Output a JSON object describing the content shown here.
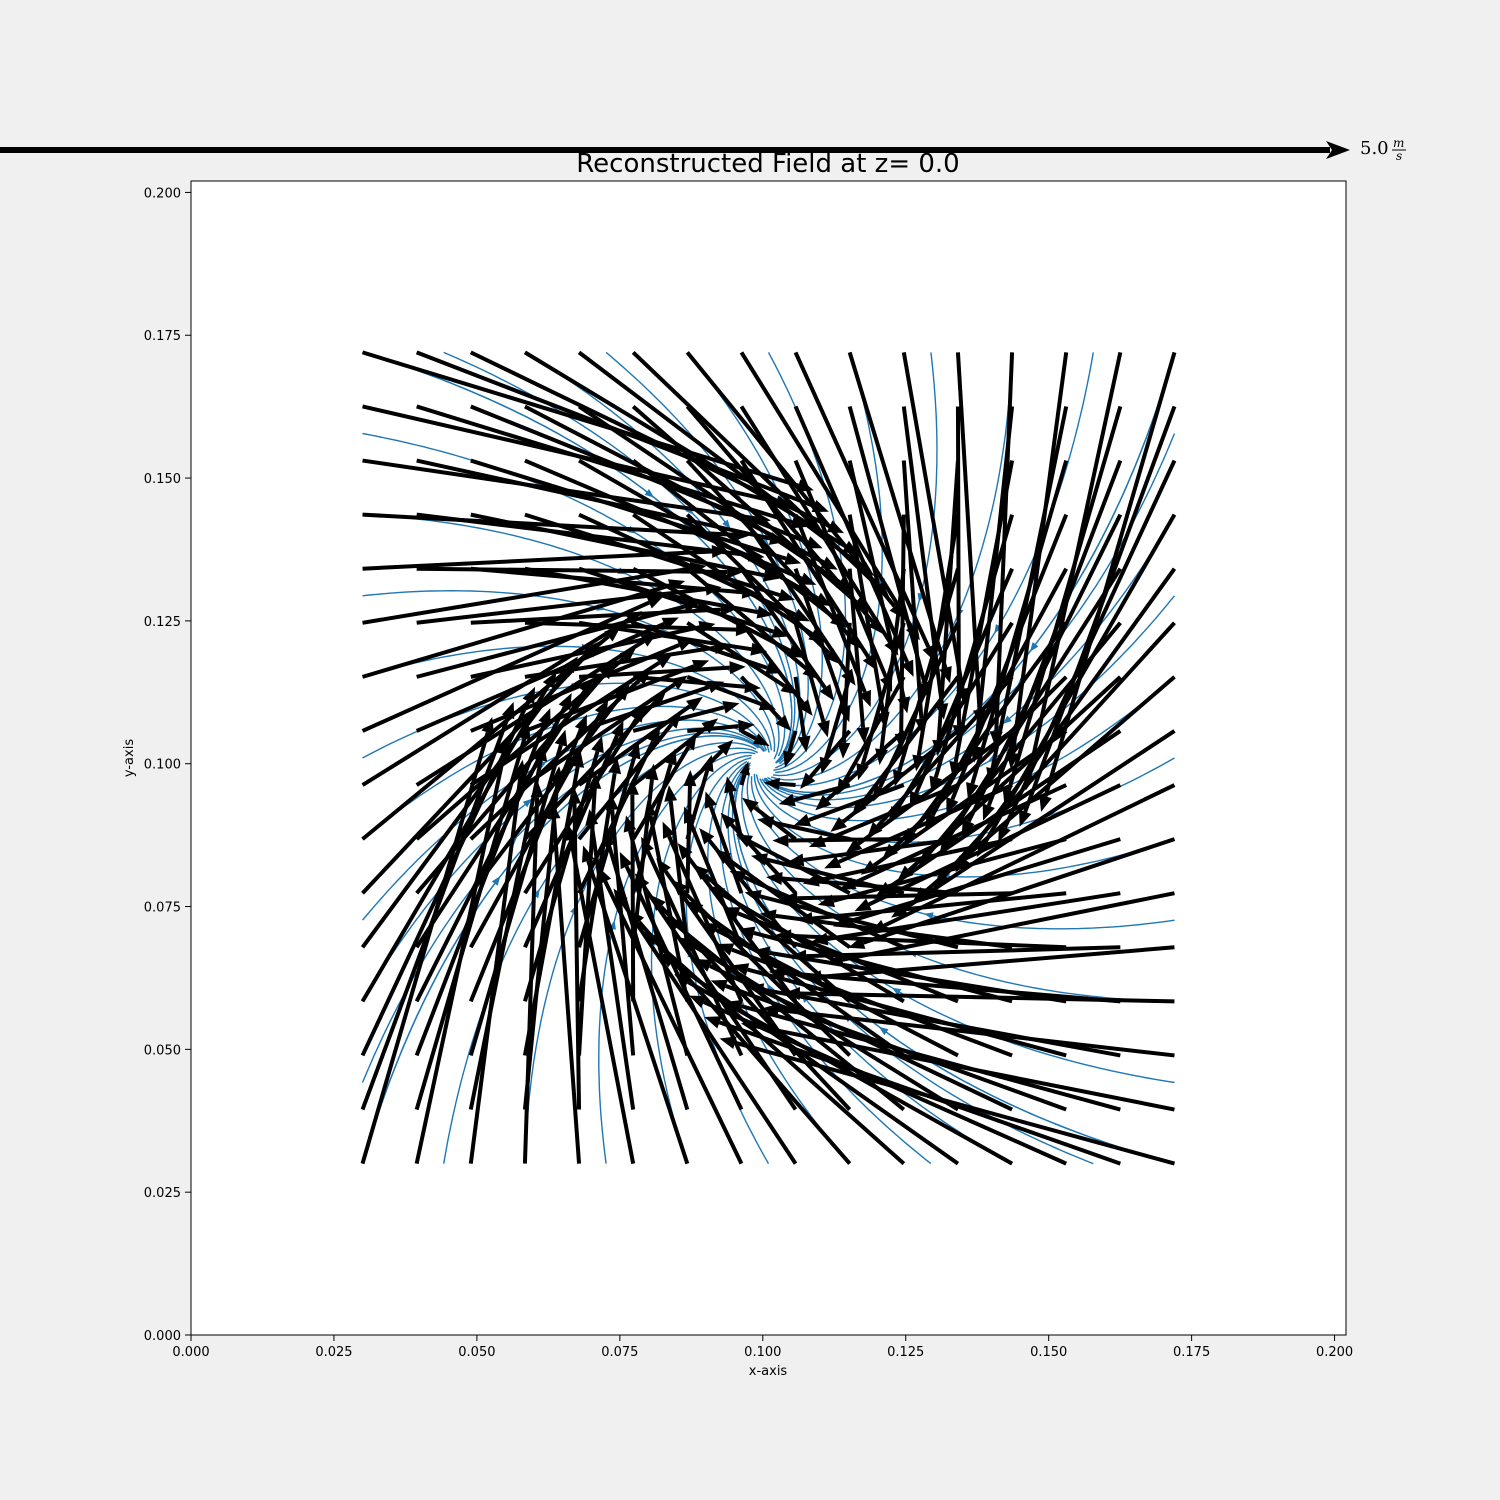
{
  "chart_data": {
    "type": "quiver+streamplot",
    "title": "Reconstructed Field at z= 0.0",
    "xlabel": "x-axis",
    "ylabel": "y-axis",
    "xlim": [
      0.0,
      0.202
    ],
    "ylim": [
      0.0,
      0.202
    ],
    "xticks": [
      "0.000",
      "0.025",
      "0.050",
      "0.075",
      "0.100",
      "0.125",
      "0.150",
      "0.175",
      "0.200"
    ],
    "yticks": [
      "0.000",
      "0.025",
      "0.050",
      "0.075",
      "0.100",
      "0.125",
      "0.150",
      "0.175",
      "0.200"
    ],
    "grid": false,
    "field": {
      "x_range": [
        0.03,
        0.172
      ],
      "y_range": [
        0.03,
        0.172
      ],
      "grid_n": 16,
      "center": [
        0.1,
        0.1
      ],
      "description_components": "converging toward center with clockwise swirl"
    },
    "quiver_key": {
      "value": 5.0,
      "label": "5.0",
      "unit_num": "m",
      "unit_den": "s"
    },
    "colors": {
      "quiver": "#000000",
      "stream": "#1f77b4",
      "background": "#f0f0f0",
      "axes_bg": "#ffffff"
    }
  }
}
